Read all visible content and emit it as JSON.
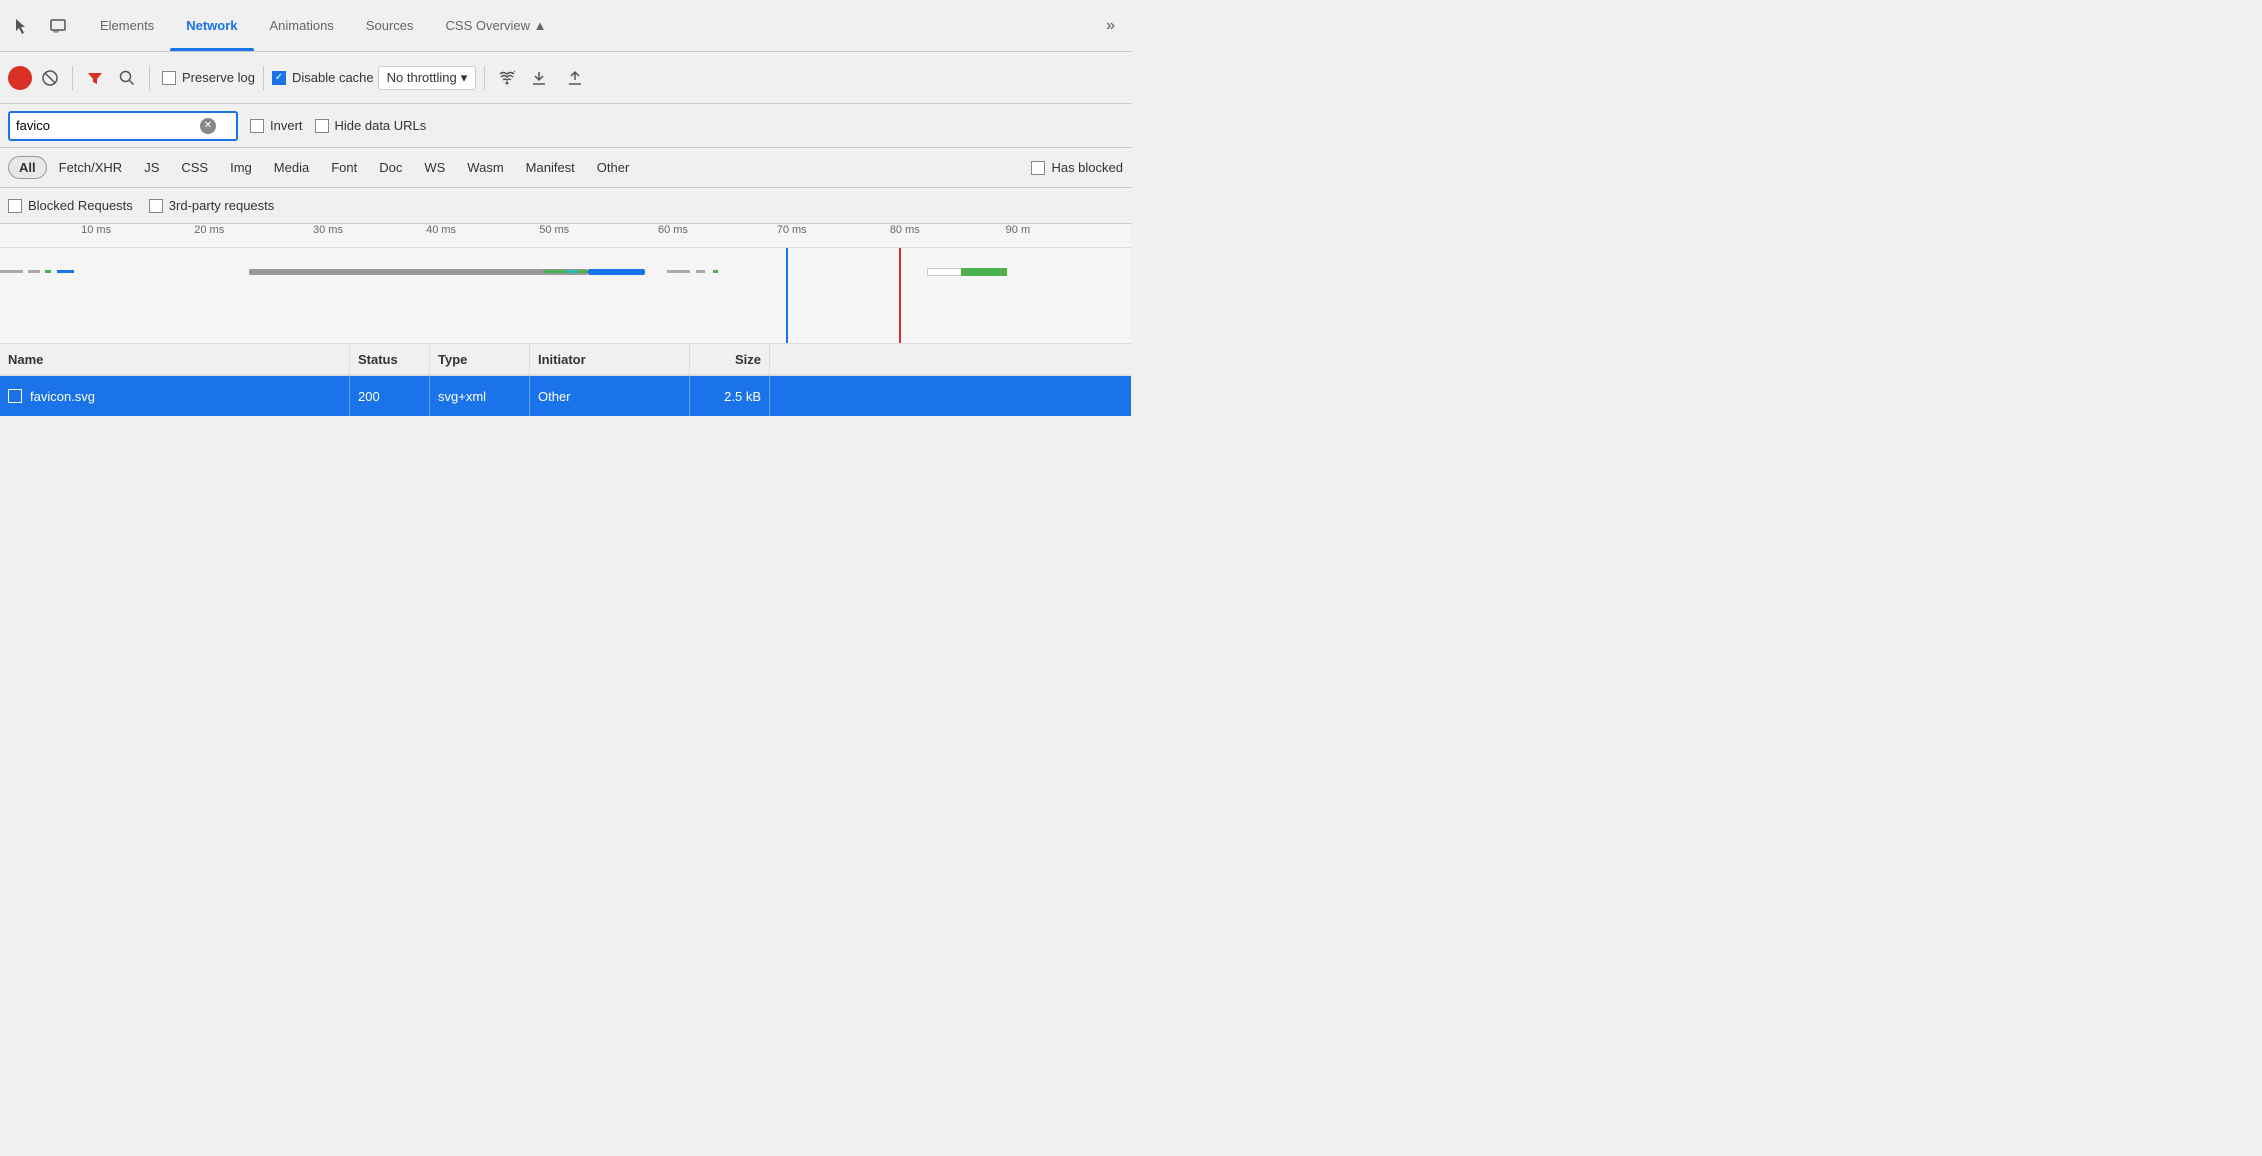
{
  "tabs": {
    "items": [
      {
        "label": "Elements",
        "active": false
      },
      {
        "label": "Network",
        "active": true
      },
      {
        "label": "Animations",
        "active": false
      },
      {
        "label": "Sources",
        "active": false
      },
      {
        "label": "CSS Overview ▲",
        "active": false
      }
    ],
    "more_label": "»"
  },
  "toolbar": {
    "preserve_log_label": "Preserve log",
    "disable_cache_label": "Disable cache",
    "throttle_label": "No throttling",
    "throttle_arrow": "▾"
  },
  "filter": {
    "search_value": "favico",
    "search_placeholder": "Filter",
    "invert_label": "Invert",
    "hide_data_label": "Hide data URLs"
  },
  "type_filters": {
    "items": [
      {
        "label": "All",
        "active": true
      },
      {
        "label": "Fetch/XHR",
        "active": false
      },
      {
        "label": "JS",
        "active": false
      },
      {
        "label": "CSS",
        "active": false
      },
      {
        "label": "Img",
        "active": false
      },
      {
        "label": "Media",
        "active": false
      },
      {
        "label": "Font",
        "active": false
      },
      {
        "label": "Doc",
        "active": false
      },
      {
        "label": "WS",
        "active": false
      },
      {
        "label": "Wasm",
        "active": false
      },
      {
        "label": "Manifest",
        "active": false
      },
      {
        "label": "Other",
        "active": false
      }
    ],
    "has_blocked_label": "Has blocked"
  },
  "blocked_row": {
    "blocked_requests_label": "Blocked Requests",
    "third_party_label": "3rd-party requests"
  },
  "timeline": {
    "ruler_labels": [
      "10 ms",
      "20 ms",
      "30 ms",
      "40 ms",
      "50 ms",
      "60 ms",
      "70 ms",
      "80 ms",
      "90 m"
    ]
  },
  "table": {
    "columns": [
      "Name",
      "Status",
      "Type",
      "Initiator",
      "Size"
    ],
    "rows": [
      {
        "name": "favicon.svg",
        "status": "200",
        "type": "svg+xml",
        "initiator": "Other",
        "size": "2.5 kB"
      }
    ]
  }
}
